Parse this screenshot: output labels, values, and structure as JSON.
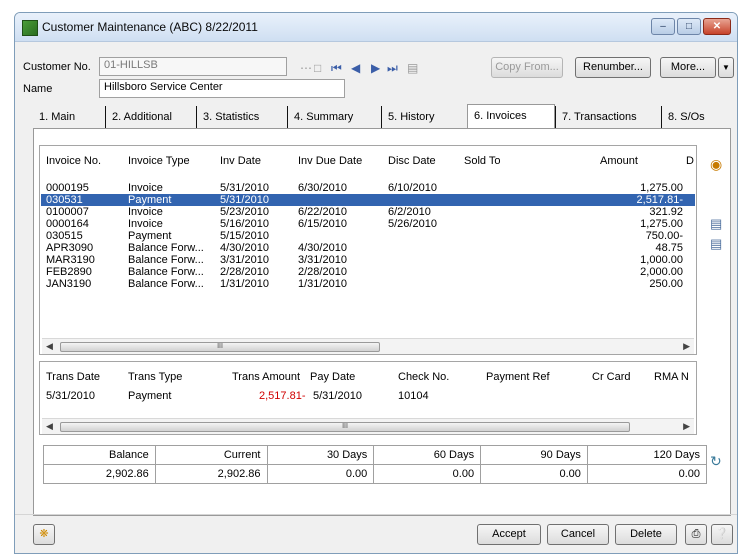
{
  "window": {
    "title": "Customer Maintenance (ABC) 8/22/2011"
  },
  "header": {
    "customer_no_label": "Customer No.",
    "customer_no_value": "01-HILLSB",
    "name_label": "Name",
    "name_value": "Hillsboro Service Center",
    "copy_from": "Copy From...",
    "renumber": "Renumber...",
    "more": "More..."
  },
  "tabs": [
    {
      "label": "1. Main"
    },
    {
      "label": "2. Additional"
    },
    {
      "label": "3. Statistics"
    },
    {
      "label": "4. Summary"
    },
    {
      "label": "5. History"
    },
    {
      "label": "6. Invoices"
    },
    {
      "label": "7. Transactions"
    },
    {
      "label": "8. S/Os"
    }
  ],
  "invoices": {
    "columns": [
      "Invoice No.",
      "Invoice Type",
      "Inv Date",
      "Inv Due Date",
      "Disc Date",
      "Sold To",
      "Amount",
      "D"
    ],
    "rows": [
      [
        "0000195",
        "Invoice",
        "5/31/2010",
        "6/30/2010",
        "6/10/2010",
        "",
        "1,275.00"
      ],
      [
        "030531",
        "Payment",
        "5/31/2010",
        "",
        "",
        "",
        "2,517.81-"
      ],
      [
        "0100007",
        "Invoice",
        "5/23/2010",
        "6/22/2010",
        "6/2/2010",
        "",
        "321.92"
      ],
      [
        "0000164",
        "Invoice",
        "5/16/2010",
        "6/15/2010",
        "5/26/2010",
        "",
        "1,275.00"
      ],
      [
        "030515",
        "Payment",
        "5/15/2010",
        "",
        "",
        "",
        "750.00-"
      ],
      [
        "APR3090",
        "Balance Forw...",
        "4/30/2010",
        "4/30/2010",
        "",
        "",
        "48.75"
      ],
      [
        "MAR3190",
        "Balance Forw...",
        "3/31/2010",
        "3/31/2010",
        "",
        "",
        "1,000.00"
      ],
      [
        "FEB2890",
        "Balance Forw...",
        "2/28/2010",
        "2/28/2010",
        "",
        "",
        "2,000.00"
      ],
      [
        "JAN3190",
        "Balance Forw...",
        "1/31/2010",
        "1/31/2010",
        "",
        "",
        "250.00"
      ]
    ],
    "selected_index": 1
  },
  "transactions": {
    "columns": [
      "Trans Date",
      "Trans Type",
      "Trans Amount",
      "Pay Date",
      "Check No.",
      "Payment Ref",
      "Cr Card",
      "RMA N"
    ],
    "rows": [
      [
        "5/31/2010",
        "Payment",
        "2,517.81-",
        "5/31/2010",
        "10104",
        "",
        "",
        ""
      ]
    ]
  },
  "aging": {
    "headers": [
      "Balance",
      "Current",
      "30 Days",
      "60 Days",
      "90 Days",
      "120 Days"
    ],
    "values": [
      "2,902.86",
      "2,902.86",
      "0.00",
      "0.00",
      "0.00",
      "0.00"
    ]
  },
  "footer": {
    "accept": "Accept",
    "cancel": "Cancel",
    "delete": "Delete"
  },
  "scroll_thumb": "III",
  "colors": {
    "selection": "#3264b0",
    "negative_amount": "#d00000"
  }
}
